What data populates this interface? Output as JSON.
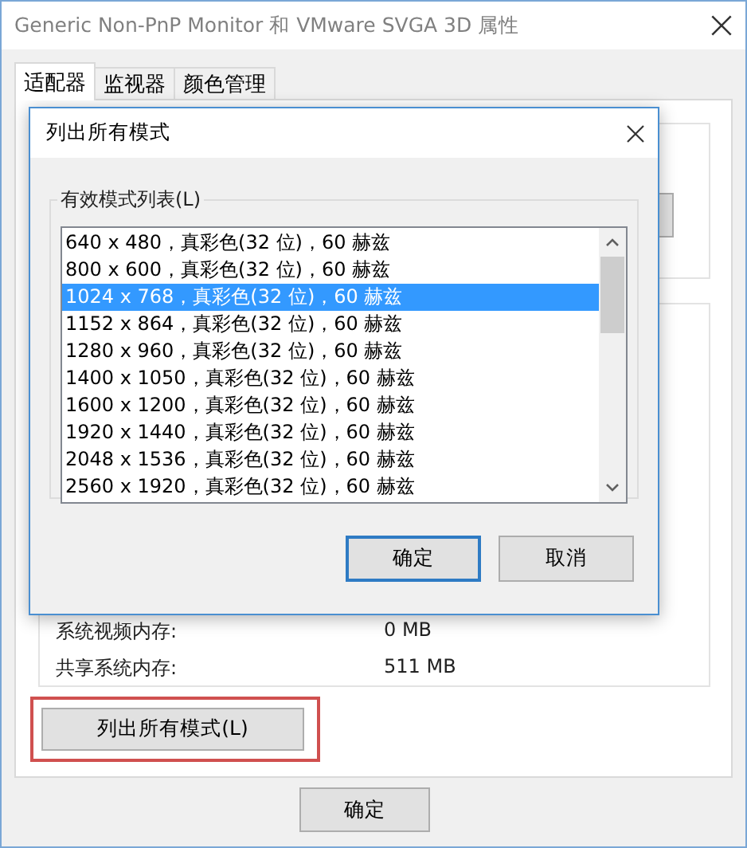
{
  "window": {
    "title": "Generic Non-PnP Monitor 和 VMware SVGA 3D 属性"
  },
  "tabs": [
    {
      "label": "适配器",
      "selected": true
    },
    {
      "label": "监视器",
      "selected": false
    },
    {
      "label": "颜色管理",
      "selected": false
    }
  ],
  "memory_info": [
    {
      "label": "系统视频内存:",
      "value": "0 MB"
    },
    {
      "label": "共享系统内存:",
      "value": "511 MB"
    }
  ],
  "list_modes_button": {
    "label": "列出所有模式(L)",
    "highlighted": true
  },
  "footer_buttons": [
    "确定"
  ],
  "dialog": {
    "title": "列出所有模式",
    "group_label": "有效模式列表(L)",
    "modes": [
      {
        "label": "640 x 480，真彩色(32 位)，60 赫兹",
        "selected": false
      },
      {
        "label": "800 x 600，真彩色(32 位)，60 赫兹",
        "selected": false
      },
      {
        "label": "1024 x 768，真彩色(32 位)，60 赫兹",
        "selected": true
      },
      {
        "label": "1152 x 864，真彩色(32 位)，60 赫兹",
        "selected": false
      },
      {
        "label": "1280 x 960，真彩色(32 位)，60 赫兹",
        "selected": false
      },
      {
        "label": "1400 x 1050，真彩色(32 位)，60 赫兹",
        "selected": false
      },
      {
        "label": "1600 x 1200，真彩色(32 位)，60 赫兹",
        "selected": false
      },
      {
        "label": "1920 x 1440，真彩色(32 位)，60 赫兹",
        "selected": false
      },
      {
        "label": "2048 x 1536，真彩色(32 位)，60 赫兹",
        "selected": false
      },
      {
        "label": "2560 x 1920，真彩色(32 位)，60 赫兹",
        "selected": false
      }
    ],
    "buttons": [
      {
        "label": "确定",
        "default": true
      },
      {
        "label": "取消",
        "default": false
      }
    ]
  }
}
